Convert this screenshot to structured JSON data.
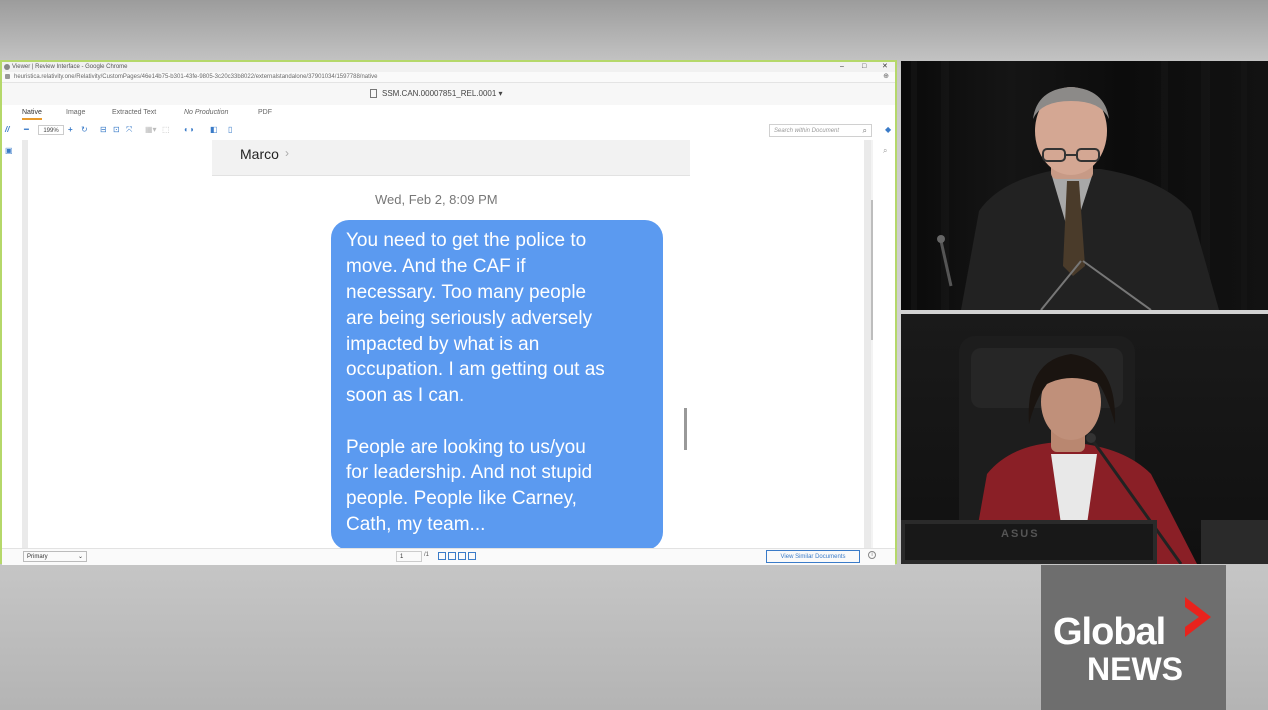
{
  "browser": {
    "window_title": "Viewer | Review Interface - Google Chrome",
    "url": "heuristica.relativity.one/Relativity/CustomPages/46e14b75-b301-43fe-9805-3c20c33b8022/externalstandalone/37901034/1597788/native",
    "window_controls": [
      "–",
      "□",
      "✕"
    ]
  },
  "document": {
    "name": "SSM.CAN.00007851_REL.0001",
    "dropdown_caret": "▾"
  },
  "view_tabs": [
    "Native",
    "Image",
    "Extracted Text",
    "No Production",
    "PDF"
  ],
  "toolbar": {
    "zoom_value": "199%",
    "search_placeholder": "Search within Document"
  },
  "message": {
    "contact_name": "Marco",
    "contact_chevron": "›",
    "timestamp": "Wed, Feb 2, 8:09 PM",
    "lines": [
      "You need to get the police to",
      "move. And the CAF if",
      "necessary. Too many people",
      "are being seriously adversely",
      "impacted by what is an",
      "occupation. I am getting out as",
      "soon as I can.",
      "",
      "People are looking to us/you",
      "for leadership. And not stupid",
      "people. People like Carney,",
      "Cath, my team..."
    ]
  },
  "status": {
    "layout_selected": "Primary",
    "page_current": "1",
    "page_total": "/1",
    "similar_button": "View Similar Documents"
  },
  "video": {
    "monitor_brand": "ASUS"
  },
  "logo": {
    "line1": "Global",
    "line2": "NEWS",
    "accent_color": "#e8231d"
  },
  "colors": {
    "bubble_blue": "#5b9af0",
    "window_border": "#b5d86a",
    "toolbar_blue": "#3a7bc8",
    "active_tab_underline": "#e89a2c"
  }
}
